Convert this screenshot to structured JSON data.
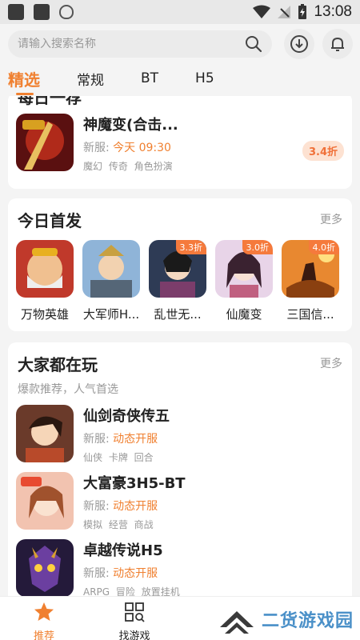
{
  "status_bar": {
    "time": "13:08"
  },
  "search": {
    "placeholder": "请输入搜索名称"
  },
  "tabs": [
    {
      "label": "精选",
      "active": true
    },
    {
      "label": "常规"
    },
    {
      "label": "BT"
    },
    {
      "label": "H5"
    }
  ],
  "section_top": {
    "heading": "每日一荐",
    "game": {
      "name": "神魔变(合击...",
      "server_prefix": "新服:",
      "server_time": "今天  09:30",
      "tags": "魔幻 传奇 角色扮演",
      "discount": "3.4折"
    }
  },
  "section_new": {
    "title": "今日首发",
    "more": "更多",
    "games": [
      {
        "name": "万物英雄",
        "discount": ""
      },
      {
        "name": "大军师H...",
        "discount": ""
      },
      {
        "name": "乱世无...",
        "discount": "3.3折"
      },
      {
        "name": "仙魔变",
        "discount": "3.0折"
      },
      {
        "name": "三国信...",
        "discount": "4.0折"
      }
    ]
  },
  "section_popular": {
    "title": "大家都在玩",
    "more": "更多",
    "subtitle": "爆款推荐，人气首选",
    "games": [
      {
        "name": "仙剑奇侠传五",
        "server_prefix": "新服:",
        "server": "动态开服",
        "tags": "仙侠 卡牌 回合"
      },
      {
        "name": "大富豪3H5-BT",
        "server_prefix": "新服:",
        "server": "动态开服",
        "tags": "模拟 经营 商战"
      },
      {
        "name": "卓越传说H5",
        "server_prefix": "新服:",
        "server": "动态开服",
        "tags": "ARPG 冒险 放置挂机"
      }
    ]
  },
  "bottom_nav": [
    {
      "label": "推荐",
      "icon": "star-icon",
      "active": true
    },
    {
      "label": "找游戏",
      "icon": "grid-search-icon"
    }
  ],
  "watermark": {
    "text": "二货游戏园"
  },
  "colors": {
    "accent": "#f08030",
    "watermark": "#4a90c8"
  }
}
